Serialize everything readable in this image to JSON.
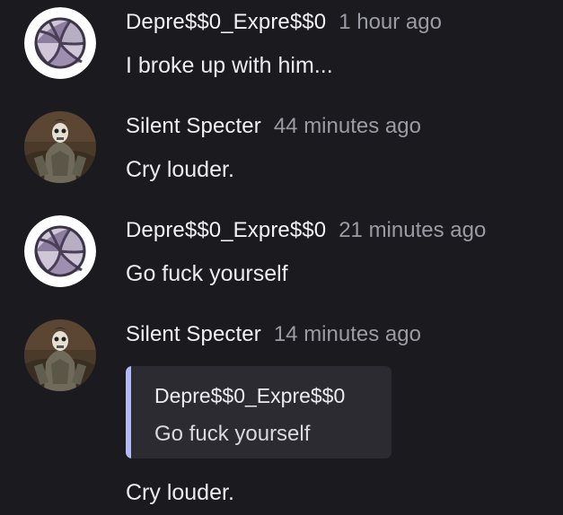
{
  "messages": [
    {
      "author": "Depre$$0_Expre$$0",
      "time": "1 hour ago",
      "text": "I broke up with him...",
      "avatar_icon": "volleyball-avatar-icon"
    },
    {
      "author": "Silent Specter",
      "time": "44 minutes ago",
      "text": "Cry louder.",
      "avatar_icon": "skeleton-soldier-avatar-icon"
    },
    {
      "author": "Depre$$0_Expre$$0",
      "time": "21 minutes ago",
      "text": "Go fuck yourself",
      "avatar_icon": "volleyball-avatar-icon"
    },
    {
      "author": "Silent Specter",
      "time": "14 minutes ago",
      "quote": {
        "author": "Depre$$0_Expre$$0",
        "text": "Go fuck yourself"
      },
      "text": "Cry louder.",
      "avatar_icon": "skeleton-soldier-avatar-icon"
    }
  ],
  "colors": {
    "background": "#1b1b1f",
    "text": "#ececf0",
    "timestamp": "#9b9ba3",
    "quote_background": "#2b2b31",
    "quote_accent": "#b4b9f5"
  }
}
